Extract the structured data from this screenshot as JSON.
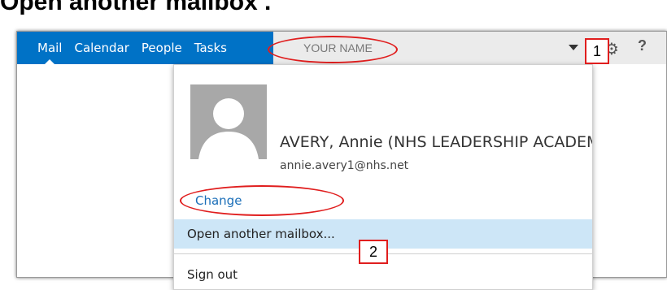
{
  "headline": "Open another mailbox’.",
  "nav": {
    "items": [
      "Mail",
      "Calendar",
      "People",
      "Tasks"
    ],
    "active": "Mail"
  },
  "user": {
    "display": "YOUR NAME",
    "full_name": "AVERY, Annie (NHS LEADERSHIP ACADEM",
    "email": "annie.avery1@nhs.net",
    "change_label": "Change"
  },
  "toolbar": {
    "dropdown_icon": "caret-down-icon",
    "settings_icon": "gear-icon",
    "help_label": "?"
  },
  "menu": {
    "open_mailbox": "Open another mailbox...",
    "sign_out": "Sign out"
  },
  "callouts": {
    "one": "1",
    "two": "2"
  },
  "colors": {
    "nav_blue": "#0072c6",
    "highlight": "#cde6f7",
    "annotation_red": "#e01e1e",
    "link_blue": "#1a6eb8"
  }
}
